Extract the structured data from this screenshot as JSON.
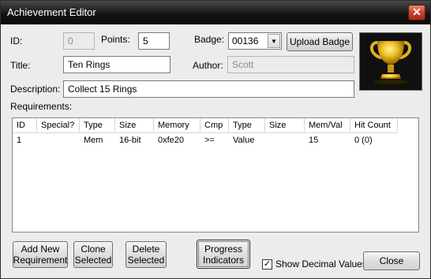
{
  "window": {
    "title": "Achievement Editor",
    "close_glyph": "✕"
  },
  "fields": {
    "id_label": "ID:",
    "id_value": "0",
    "points_label": "Points:",
    "points_value": "5",
    "badge_label": "Badge:",
    "badge_value": "00136",
    "title_label": "Title:",
    "title_value": "Ten Rings",
    "author_label": "Author:",
    "author_value": "Scott",
    "description_label": "Description:",
    "description_value": "Collect 15 Rings",
    "requirements_label": "Requirements:"
  },
  "buttons": {
    "upload_badge": "Upload Badge",
    "add_new_requirement": [
      "Add New",
      "Requirement"
    ],
    "clone_selected": [
      "Clone",
      "Selected"
    ],
    "delete_selected": [
      "Delete",
      "Selected"
    ],
    "progress_indicators": [
      "Progress",
      "Indicators"
    ],
    "close": "Close"
  },
  "show_decimal": {
    "label": "Show Decimal Values",
    "checked": true,
    "mark": "✓"
  },
  "requirements": {
    "columns": [
      "ID",
      "Special?",
      "Type",
      "Size",
      "Memory",
      "Cmp",
      "Type",
      "Size",
      "Mem/Val",
      "Hit Count"
    ],
    "rows": [
      [
        "1",
        "",
        "Mem",
        "16-bit",
        "0xfe20",
        ">=",
        "Value",
        "",
        "15",
        "0 (0)"
      ]
    ]
  },
  "badge_image": {
    "icon": "trophy-icon",
    "colors": {
      "gold": "#f0c020",
      "shadow": "#8a5a00",
      "bg": "#101010"
    }
  }
}
